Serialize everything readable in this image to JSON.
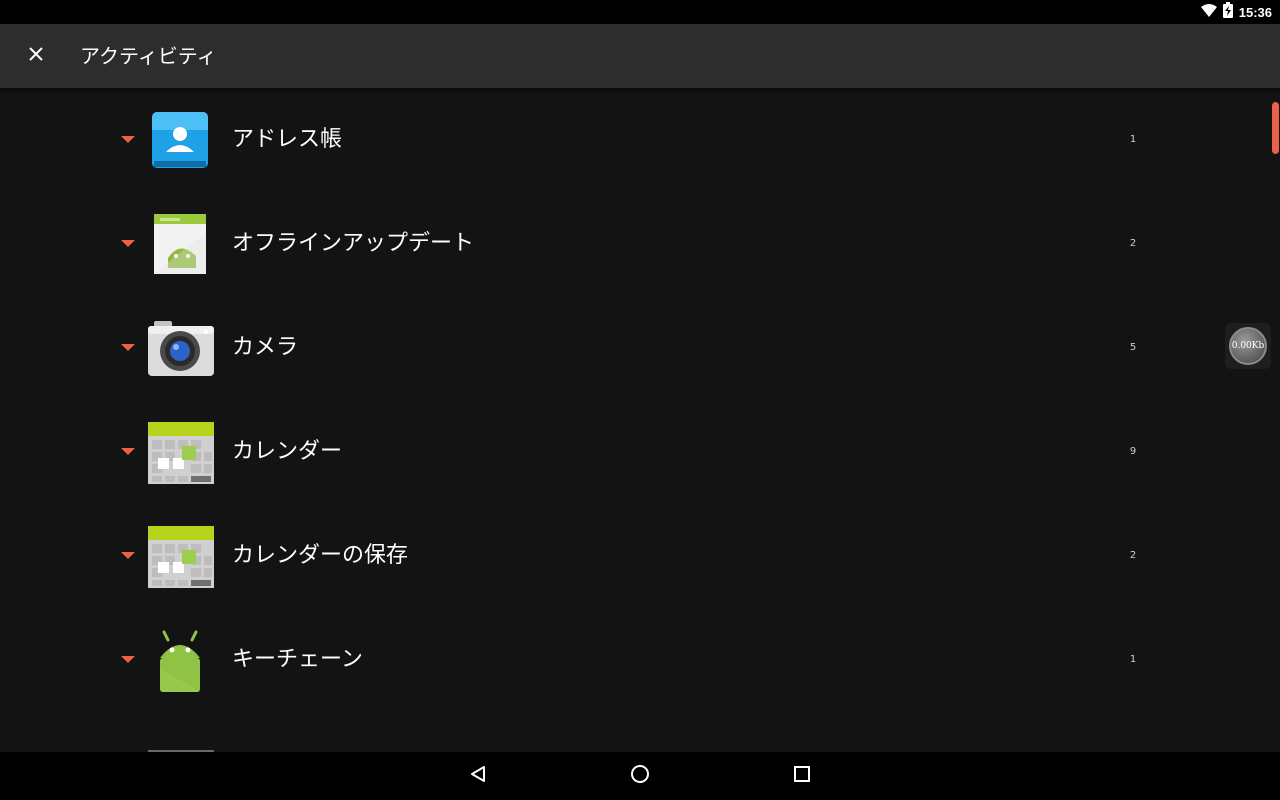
{
  "status_bar": {
    "time": "15:36",
    "icons": [
      "wifi-icon",
      "battery-charging-icon"
    ]
  },
  "header": {
    "title": "アクティビティ",
    "close_icon": "close-icon"
  },
  "list": {
    "items": [
      {
        "label": "アドレス帳",
        "count": "1",
        "icon": "contacts-icon"
      },
      {
        "label": "オフラインアップデート",
        "count": "2",
        "icon": "android-update-icon"
      },
      {
        "label": "カメラ",
        "count": "5",
        "icon": "camera-icon"
      },
      {
        "label": "カレンダー",
        "count": "9",
        "icon": "calendar-icon"
      },
      {
        "label": "カレンダーの保存",
        "count": "2",
        "icon": "calendar-icon"
      },
      {
        "label": "キーチェーン",
        "count": "1",
        "icon": "android-icon"
      },
      {
        "label": "",
        "count": "",
        "icon": "gallery-icon"
      }
    ]
  },
  "net_widget": {
    "value": "0.00Kb"
  },
  "colors": {
    "accent": "#e8624a",
    "action_bar": "#2d2d2d",
    "background": "#131313"
  },
  "nav_bar": {
    "buttons": [
      "back-icon",
      "home-icon",
      "recents-icon"
    ]
  }
}
